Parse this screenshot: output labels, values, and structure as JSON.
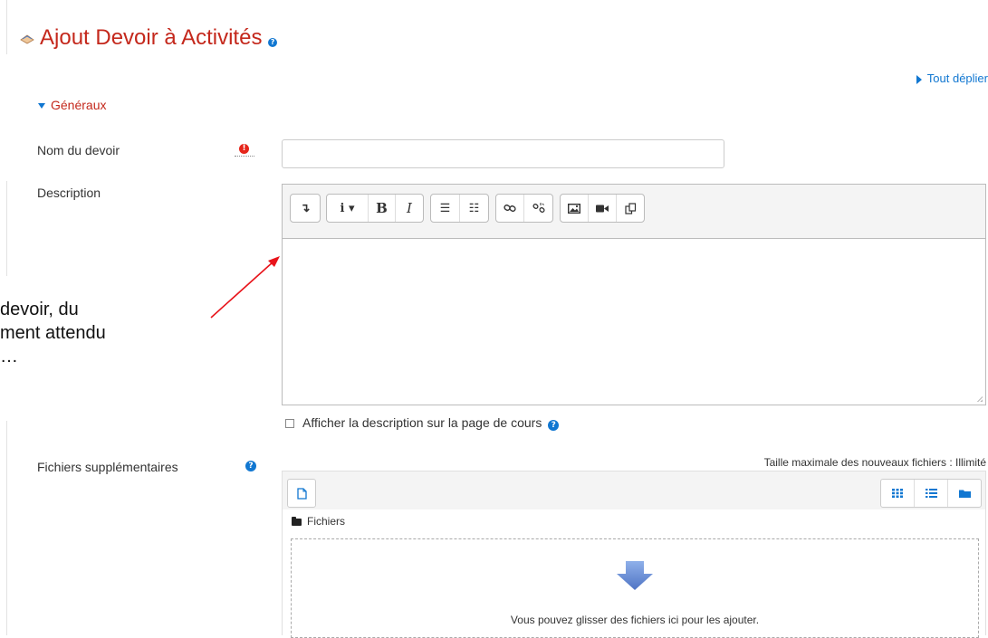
{
  "header": {
    "title": "Ajout Devoir à Activités",
    "help_glyph": "?",
    "expand_all": "Tout déplier"
  },
  "section": {
    "label": "Généraux"
  },
  "form": {
    "name_label": "Nom du devoir",
    "name_value": "",
    "required_glyph": "!",
    "description_label": "Description",
    "description_value": "",
    "show_description_label": "Afficher la description sur la page de cours",
    "files_label": "Fichiers supplémentaires",
    "max_size_text": "Taille maximale des nouveaux fichiers : Illimité"
  },
  "toolbar": {
    "buttons": [
      {
        "icon": "collapse-icon",
        "glyph": "↴"
      },
      {
        "icon": "info-dropdown-icon",
        "glyph": "i ▾"
      },
      {
        "icon": "bold-icon",
        "glyph": "B"
      },
      {
        "icon": "italic-icon",
        "glyph": "I"
      },
      {
        "icon": "unordered-list-icon",
        "glyph": "☰"
      },
      {
        "icon": "ordered-list-icon",
        "glyph": "☷"
      },
      {
        "icon": "link-icon",
        "glyph": "🔗"
      },
      {
        "icon": "unlink-icon",
        "glyph": "✂"
      },
      {
        "icon": "image-icon",
        "glyph": "▣"
      },
      {
        "icon": "video-icon",
        "glyph": "■"
      },
      {
        "icon": "manage-files-icon",
        "glyph": "⧉"
      }
    ]
  },
  "annotation": {
    "lines": [
      "devoir, du",
      "ment attendu",
      "…"
    ],
    "arrow_color": "#e8141b"
  },
  "filepicker": {
    "folder_label": "Fichiers",
    "drop_text": "Vous pouvez glisser des fichiers ici pour les ajouter.",
    "views": [
      "grid-view-icon",
      "list-view-icon",
      "tree-view-icon"
    ]
  },
  "colors": {
    "title": "#c4281c",
    "accent": "#1177d1",
    "required": "#e6251a",
    "drop_arrow": "#6b8fd6"
  }
}
